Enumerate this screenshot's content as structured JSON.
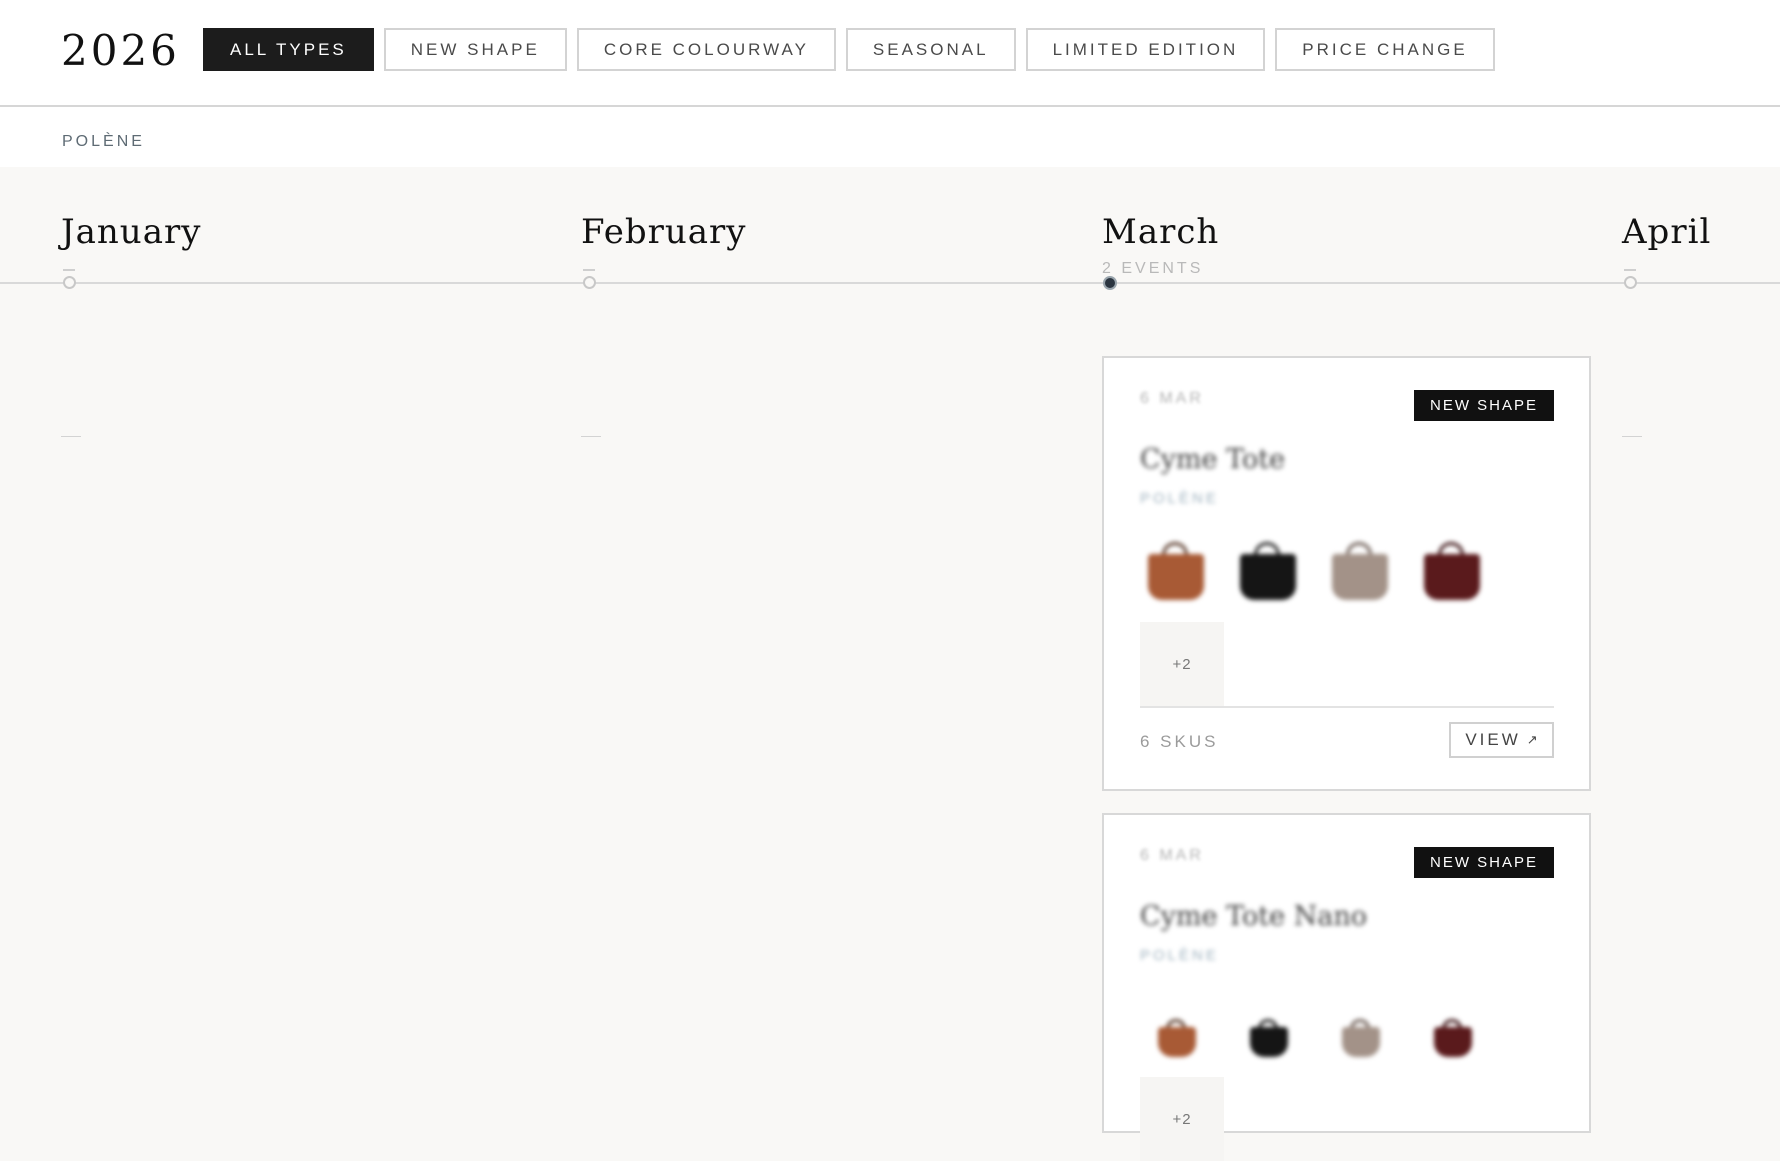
{
  "header": {
    "year": "2026",
    "filters": [
      {
        "label": "ALL TYPES",
        "active": true
      },
      {
        "label": "NEW SHAPE",
        "active": false
      },
      {
        "label": "CORE COLOURWAY",
        "active": false
      },
      {
        "label": "SEASONAL",
        "active": false
      },
      {
        "label": "LIMITED EDITION",
        "active": false
      },
      {
        "label": "PRICE CHANGE",
        "active": false
      }
    ]
  },
  "brand_label": "POLÈNE",
  "timeline": {
    "months": [
      {
        "name": "January",
        "event_count": ""
      },
      {
        "name": "February",
        "event_count": ""
      },
      {
        "name": "March",
        "event_count": "2 EVENTS",
        "selected": true
      },
      {
        "name": "April",
        "event_count": ""
      }
    ]
  },
  "events": [
    {
      "date": "6 MAR",
      "badge": "NEW SHAPE",
      "title": "Cyme Tote",
      "brand": "POLÈNE",
      "more": "+2",
      "skus": "6 SKUS",
      "view_label": "VIEW",
      "view_icon": "arrow-up-right-icon",
      "swatch_colors": [
        "#a85a35",
        "#151515",
        "#a39288",
        "#5a1a1c"
      ]
    },
    {
      "date": "6 MAR",
      "badge": "NEW SHAPE",
      "title": "Cyme Tote Nano",
      "brand": "POLÈNE",
      "more": "+2",
      "swatch_colors": [
        "#a85a35",
        "#151515",
        "#a39288",
        "#5a1a1c"
      ]
    }
  ],
  "colors": {
    "accent": "#1c1c1c",
    "brand_text": "#5e6b74",
    "selected_dot": "#2b3540"
  }
}
